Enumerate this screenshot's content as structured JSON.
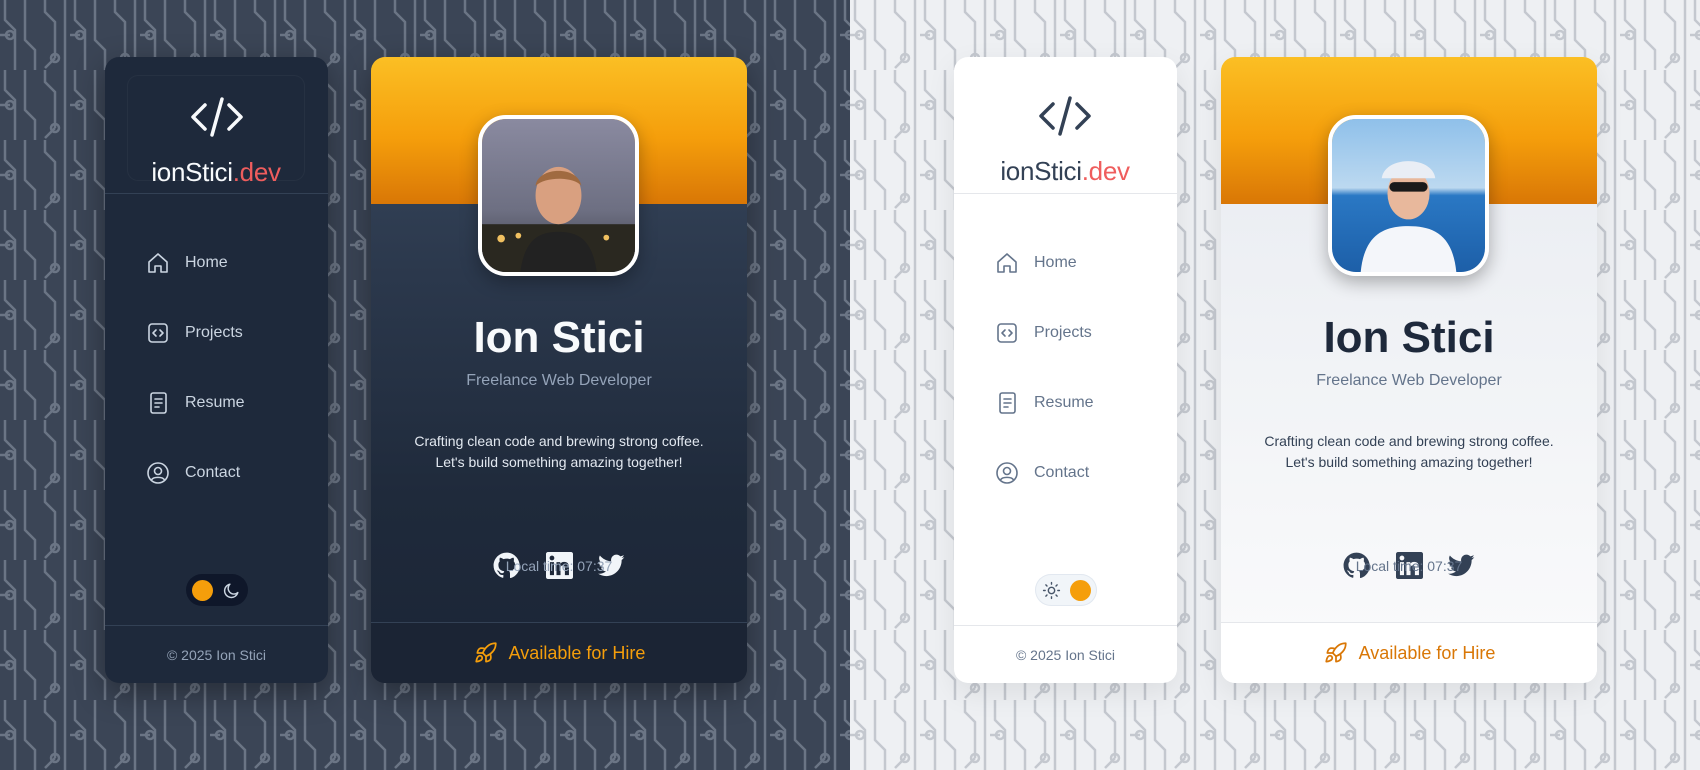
{
  "brand": {
    "name": "ionStici",
    "tld": ".dev"
  },
  "nav": {
    "items": [
      {
        "label": "Home",
        "icon": "home-icon"
      },
      {
        "label": "Projects",
        "icon": "code-file-icon"
      },
      {
        "label": "Resume",
        "icon": "document-icon"
      },
      {
        "label": "Contact",
        "icon": "user-circle-icon"
      }
    ]
  },
  "footer": {
    "copyright": "© 2025 Ion Stici"
  },
  "profile": {
    "name": "Ion Stici",
    "role": "Freelance Web Developer",
    "bio_line1": "Crafting clean code and brewing strong coffee.",
    "bio_line2": "Let's build something amazing together!",
    "local_time": "Local time: 07:37",
    "hire_label": "Available for Hire",
    "socials": [
      "github-icon",
      "linkedin-icon",
      "twitter-icon"
    ]
  },
  "theme": {
    "dark_toggle_state": "dark",
    "light_toggle_state": "light",
    "accent": "#f59e0b",
    "brand_tld_color": "#ef5d5d"
  }
}
